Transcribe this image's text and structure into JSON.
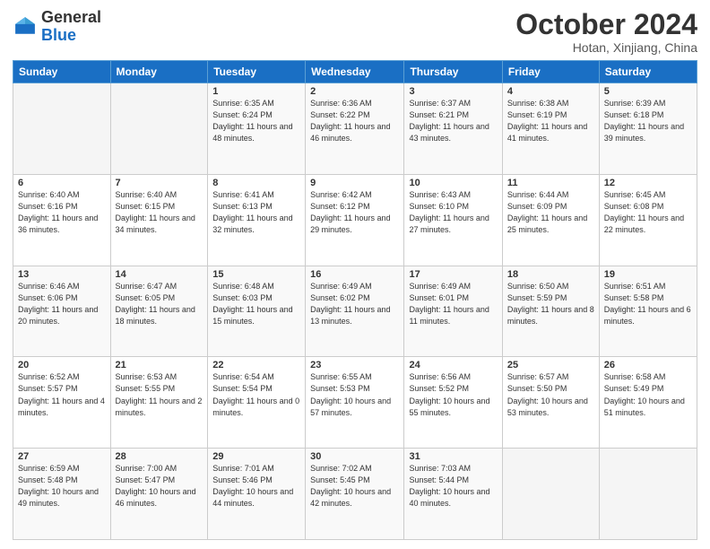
{
  "header": {
    "logo_general": "General",
    "logo_blue": "Blue",
    "month_title": "October 2024",
    "location": "Hotan, Xinjiang, China"
  },
  "weekdays": [
    "Sunday",
    "Monday",
    "Tuesday",
    "Wednesday",
    "Thursday",
    "Friday",
    "Saturday"
  ],
  "weeks": [
    [
      {
        "day": "",
        "sunrise": "",
        "sunset": "",
        "daylight": ""
      },
      {
        "day": "",
        "sunrise": "",
        "sunset": "",
        "daylight": ""
      },
      {
        "day": "1",
        "sunrise": "Sunrise: 6:35 AM",
        "sunset": "Sunset: 6:24 PM",
        "daylight": "Daylight: 11 hours and 48 minutes."
      },
      {
        "day": "2",
        "sunrise": "Sunrise: 6:36 AM",
        "sunset": "Sunset: 6:22 PM",
        "daylight": "Daylight: 11 hours and 46 minutes."
      },
      {
        "day": "3",
        "sunrise": "Sunrise: 6:37 AM",
        "sunset": "Sunset: 6:21 PM",
        "daylight": "Daylight: 11 hours and 43 minutes."
      },
      {
        "day": "4",
        "sunrise": "Sunrise: 6:38 AM",
        "sunset": "Sunset: 6:19 PM",
        "daylight": "Daylight: 11 hours and 41 minutes."
      },
      {
        "day": "5",
        "sunrise": "Sunrise: 6:39 AM",
        "sunset": "Sunset: 6:18 PM",
        "daylight": "Daylight: 11 hours and 39 minutes."
      }
    ],
    [
      {
        "day": "6",
        "sunrise": "Sunrise: 6:40 AM",
        "sunset": "Sunset: 6:16 PM",
        "daylight": "Daylight: 11 hours and 36 minutes."
      },
      {
        "day": "7",
        "sunrise": "Sunrise: 6:40 AM",
        "sunset": "Sunset: 6:15 PM",
        "daylight": "Daylight: 11 hours and 34 minutes."
      },
      {
        "day": "8",
        "sunrise": "Sunrise: 6:41 AM",
        "sunset": "Sunset: 6:13 PM",
        "daylight": "Daylight: 11 hours and 32 minutes."
      },
      {
        "day": "9",
        "sunrise": "Sunrise: 6:42 AM",
        "sunset": "Sunset: 6:12 PM",
        "daylight": "Daylight: 11 hours and 29 minutes."
      },
      {
        "day": "10",
        "sunrise": "Sunrise: 6:43 AM",
        "sunset": "Sunset: 6:10 PM",
        "daylight": "Daylight: 11 hours and 27 minutes."
      },
      {
        "day": "11",
        "sunrise": "Sunrise: 6:44 AM",
        "sunset": "Sunset: 6:09 PM",
        "daylight": "Daylight: 11 hours and 25 minutes."
      },
      {
        "day": "12",
        "sunrise": "Sunrise: 6:45 AM",
        "sunset": "Sunset: 6:08 PM",
        "daylight": "Daylight: 11 hours and 22 minutes."
      }
    ],
    [
      {
        "day": "13",
        "sunrise": "Sunrise: 6:46 AM",
        "sunset": "Sunset: 6:06 PM",
        "daylight": "Daylight: 11 hours and 20 minutes."
      },
      {
        "day": "14",
        "sunrise": "Sunrise: 6:47 AM",
        "sunset": "Sunset: 6:05 PM",
        "daylight": "Daylight: 11 hours and 18 minutes."
      },
      {
        "day": "15",
        "sunrise": "Sunrise: 6:48 AM",
        "sunset": "Sunset: 6:03 PM",
        "daylight": "Daylight: 11 hours and 15 minutes."
      },
      {
        "day": "16",
        "sunrise": "Sunrise: 6:49 AM",
        "sunset": "Sunset: 6:02 PM",
        "daylight": "Daylight: 11 hours and 13 minutes."
      },
      {
        "day": "17",
        "sunrise": "Sunrise: 6:49 AM",
        "sunset": "Sunset: 6:01 PM",
        "daylight": "Daylight: 11 hours and 11 minutes."
      },
      {
        "day": "18",
        "sunrise": "Sunrise: 6:50 AM",
        "sunset": "Sunset: 5:59 PM",
        "daylight": "Daylight: 11 hours and 8 minutes."
      },
      {
        "day": "19",
        "sunrise": "Sunrise: 6:51 AM",
        "sunset": "Sunset: 5:58 PM",
        "daylight": "Daylight: 11 hours and 6 minutes."
      }
    ],
    [
      {
        "day": "20",
        "sunrise": "Sunrise: 6:52 AM",
        "sunset": "Sunset: 5:57 PM",
        "daylight": "Daylight: 11 hours and 4 minutes."
      },
      {
        "day": "21",
        "sunrise": "Sunrise: 6:53 AM",
        "sunset": "Sunset: 5:55 PM",
        "daylight": "Daylight: 11 hours and 2 minutes."
      },
      {
        "day": "22",
        "sunrise": "Sunrise: 6:54 AM",
        "sunset": "Sunset: 5:54 PM",
        "daylight": "Daylight: 11 hours and 0 minutes."
      },
      {
        "day": "23",
        "sunrise": "Sunrise: 6:55 AM",
        "sunset": "Sunset: 5:53 PM",
        "daylight": "Daylight: 10 hours and 57 minutes."
      },
      {
        "day": "24",
        "sunrise": "Sunrise: 6:56 AM",
        "sunset": "Sunset: 5:52 PM",
        "daylight": "Daylight: 10 hours and 55 minutes."
      },
      {
        "day": "25",
        "sunrise": "Sunrise: 6:57 AM",
        "sunset": "Sunset: 5:50 PM",
        "daylight": "Daylight: 10 hours and 53 minutes."
      },
      {
        "day": "26",
        "sunrise": "Sunrise: 6:58 AM",
        "sunset": "Sunset: 5:49 PM",
        "daylight": "Daylight: 10 hours and 51 minutes."
      }
    ],
    [
      {
        "day": "27",
        "sunrise": "Sunrise: 6:59 AM",
        "sunset": "Sunset: 5:48 PM",
        "daylight": "Daylight: 10 hours and 49 minutes."
      },
      {
        "day": "28",
        "sunrise": "Sunrise: 7:00 AM",
        "sunset": "Sunset: 5:47 PM",
        "daylight": "Daylight: 10 hours and 46 minutes."
      },
      {
        "day": "29",
        "sunrise": "Sunrise: 7:01 AM",
        "sunset": "Sunset: 5:46 PM",
        "daylight": "Daylight: 10 hours and 44 minutes."
      },
      {
        "day": "30",
        "sunrise": "Sunrise: 7:02 AM",
        "sunset": "Sunset: 5:45 PM",
        "daylight": "Daylight: 10 hours and 42 minutes."
      },
      {
        "day": "31",
        "sunrise": "Sunrise: 7:03 AM",
        "sunset": "Sunset: 5:44 PM",
        "daylight": "Daylight: 10 hours and 40 minutes."
      },
      {
        "day": "",
        "sunrise": "",
        "sunset": "",
        "daylight": ""
      },
      {
        "day": "",
        "sunrise": "",
        "sunset": "",
        "daylight": ""
      }
    ]
  ]
}
